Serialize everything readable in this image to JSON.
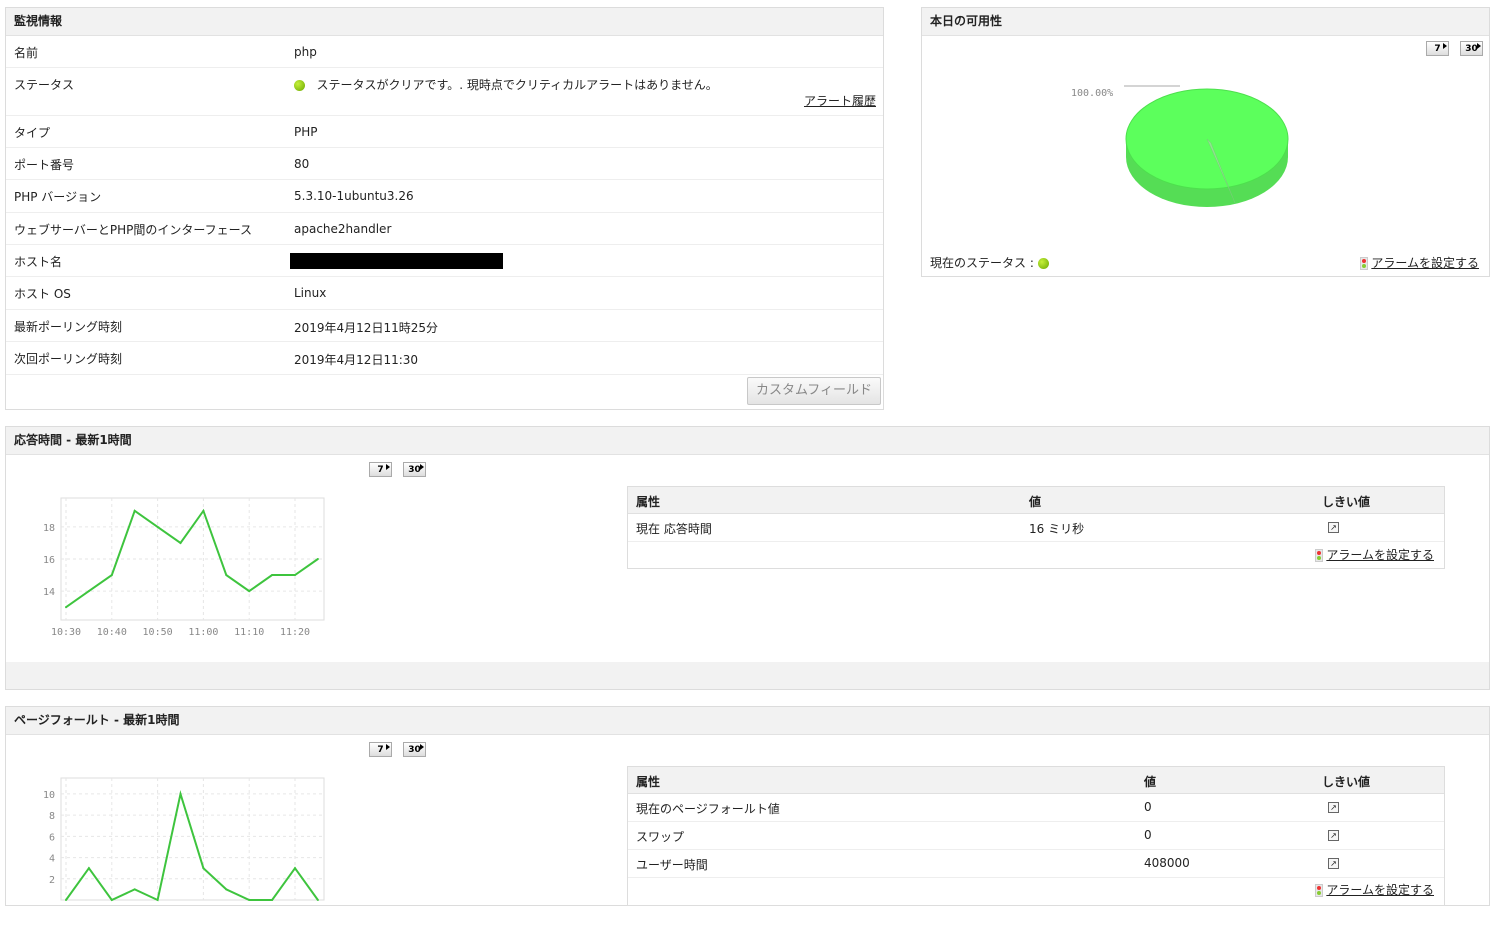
{
  "monitor_info": {
    "title": "監視情報",
    "rows": [
      {
        "label": "名前",
        "value": "php"
      },
      {
        "label": "ステータス",
        "value": "ステータスがクリアです。. 現時点でクリティカルアラートはありません。"
      },
      {
        "label": "タイプ",
        "value": "PHP"
      },
      {
        "label": "ポート番号",
        "value": "80"
      },
      {
        "label": "PHP バージョン",
        "value": "5.3.10-1ubuntu3.26"
      },
      {
        "label": "ウェブサーバーとPHP間のインターフェース",
        "value": "apache2handler"
      },
      {
        "label": "ホスト名",
        "value": ""
      },
      {
        "label": "ホスト OS",
        "value": "Linux"
      },
      {
        "label": "最新ポーリング時刻",
        "value": "2019年4月12日11時25分"
      },
      {
        "label": "次回ポーリング時刻",
        "value": "2019年4月12日11:30"
      }
    ],
    "alert_history_link": "アラート履歴",
    "custom_field_button": "カスタムフィールド"
  },
  "availability": {
    "title": "本日の可用性",
    "period_7": "7",
    "period_30": "30",
    "pie_label": "100.00%",
    "current_status_label": "現在のステータス :",
    "set_alarm": "アラームを設定する",
    "status_color": "#7ec000"
  },
  "response_time": {
    "title": "応答時間 - 最新1時間",
    "period_7": "7",
    "period_30": "30",
    "table": {
      "headers": [
        "属性",
        "値",
        "しきい値"
      ],
      "rows": [
        {
          "attr": "現在 応答時間",
          "value": "16 ミリ秒"
        }
      ],
      "set_alarm": "アラームを設定する"
    }
  },
  "page_faults": {
    "title": "ページフォールト - 最新1時間",
    "period_7": "7",
    "period_30": "30",
    "table": {
      "headers": [
        "属性",
        "値",
        "しきい値"
      ],
      "rows": [
        {
          "attr": "現在のページフォールト値",
          "value": "0"
        },
        {
          "attr": "スワップ",
          "value": "0"
        },
        {
          "attr": "ユーザー時間",
          "value": "408000"
        }
      ],
      "set_alarm": "アラームを設定する"
    }
  },
  "chart_data": [
    {
      "type": "line",
      "title": "応答時間 - 最新1時間",
      "x": [
        "10:30",
        "10:35",
        "10:40",
        "10:45",
        "10:50",
        "10:55",
        "11:00",
        "11:05",
        "11:10",
        "11:15",
        "11:20",
        "11:25"
      ],
      "values": [
        13,
        14,
        15,
        19,
        18,
        17,
        19,
        15,
        14,
        15,
        15,
        16
      ],
      "xticks": [
        "10:30",
        "10:40",
        "10:50",
        "11:00",
        "11:10",
        "11:20"
      ],
      "yticks": [
        14,
        16,
        18
      ],
      "ylim": [
        12.2,
        19.8
      ],
      "color": "#3ec43e",
      "grid": true
    },
    {
      "type": "line",
      "title": "ページフォールト - 最新1時間",
      "x": [
        "10:30",
        "10:35",
        "10:40",
        "10:45",
        "10:50",
        "10:55",
        "11:00",
        "11:05",
        "11:10",
        "11:15",
        "11:20",
        "11:25"
      ],
      "values": [
        0,
        3,
        0,
        1,
        0,
        10,
        3,
        1,
        0,
        0,
        3,
        0
      ],
      "yticks": [
        2,
        4,
        6,
        8,
        10
      ],
      "ylim": [
        0,
        11.5
      ],
      "color": "#3ec43e",
      "grid": true
    },
    {
      "type": "pie",
      "title": "本日の可用性",
      "slices": [
        {
          "label": "100.00%",
          "value": 100,
          "color": "#5cff5c"
        }
      ]
    }
  ]
}
